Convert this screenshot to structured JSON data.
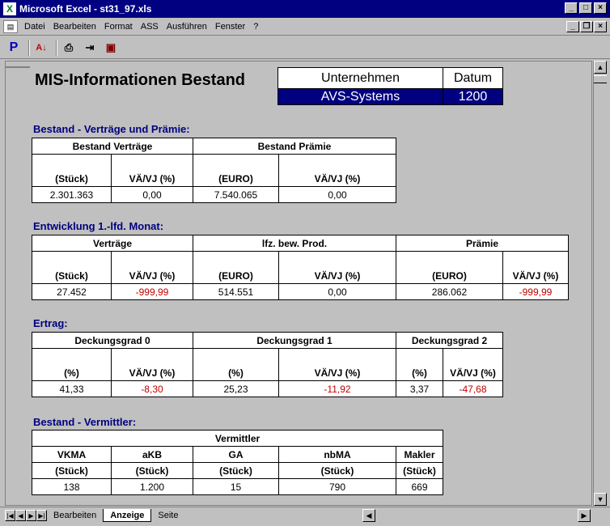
{
  "window": {
    "title": "Microsoft Excel - st31_97.xls"
  },
  "menu": [
    "Datei",
    "Bearbeiten",
    "Format",
    "ASS",
    "Ausführen",
    "Fenster",
    "?"
  ],
  "toolbar": {
    "p_label": "P"
  },
  "report": {
    "title": "MIS-Informationen Bestand",
    "company_header": "Unternehmen",
    "date_header": "Datum",
    "company": "AVS-Systems",
    "date": "1200"
  },
  "s1": {
    "title": "Bestand - Verträge und Prämie:",
    "g1": "Bestand Verträge",
    "g2": "Bestand Prämie",
    "c1": "(Stück)",
    "c2": "VÄ/VJ (%)",
    "c3": "(EURO)",
    "c4": "VÄ/VJ (%)",
    "v1": "2.301.363",
    "v2": "0,00",
    "v3": "7.540.065",
    "v4": "0,00"
  },
  "s2": {
    "title": "Entwicklung 1.-lfd. Monat:",
    "g1": "Verträge",
    "g2": "lfz. bew. Prod.",
    "g3": "Prämie",
    "c1": "(Stück)",
    "c2": "VÄ/VJ (%)",
    "c3": "(EURO)",
    "c4": "VÄ/VJ (%)",
    "c5": "(EURO)",
    "c6": "VÄ/VJ (%)",
    "v1": "27.452",
    "v2": "-999,99",
    "v3": "514.551",
    "v4": "0,00",
    "v5": "286.062",
    "v6": "-999,99"
  },
  "s3": {
    "title": "Ertrag:",
    "g1": "Deckungsgrad 0",
    "g2": "Deckungsgrad 1",
    "g3": "Deckungsgrad 2",
    "c1": "(%)",
    "c2": "VÄ/VJ (%)",
    "c3": "(%)",
    "c4": "VÄ/VJ (%)",
    "c5": "(%)",
    "c6": "VÄ/VJ (%)",
    "v1": "41,33",
    "v2": "-8,30",
    "v3": "25,23",
    "v4": "-11,92",
    "v5": "3,37",
    "v6": "-47,68"
  },
  "s4": {
    "title": "Bestand - Vermittler:",
    "g1": "Vermittler",
    "n1": "VKMA",
    "n2": "aKB",
    "n3": "GA",
    "n4": "nbMA",
    "n5": "Makler",
    "u1": "(Stück)",
    "u2": "(Stück)",
    "u3": "(Stück)",
    "u4": "(Stück)",
    "u5": "(Stück)",
    "v1": "138",
    "v2": "1.200",
    "v3": "15",
    "v4": "790",
    "v5": "669"
  },
  "tabs": [
    "Bearbeiten",
    "Anzeige",
    "Seite"
  ],
  "colors": {
    "titlebar": "#000080",
    "heading": "#000080",
    "negative": "#c00000"
  }
}
